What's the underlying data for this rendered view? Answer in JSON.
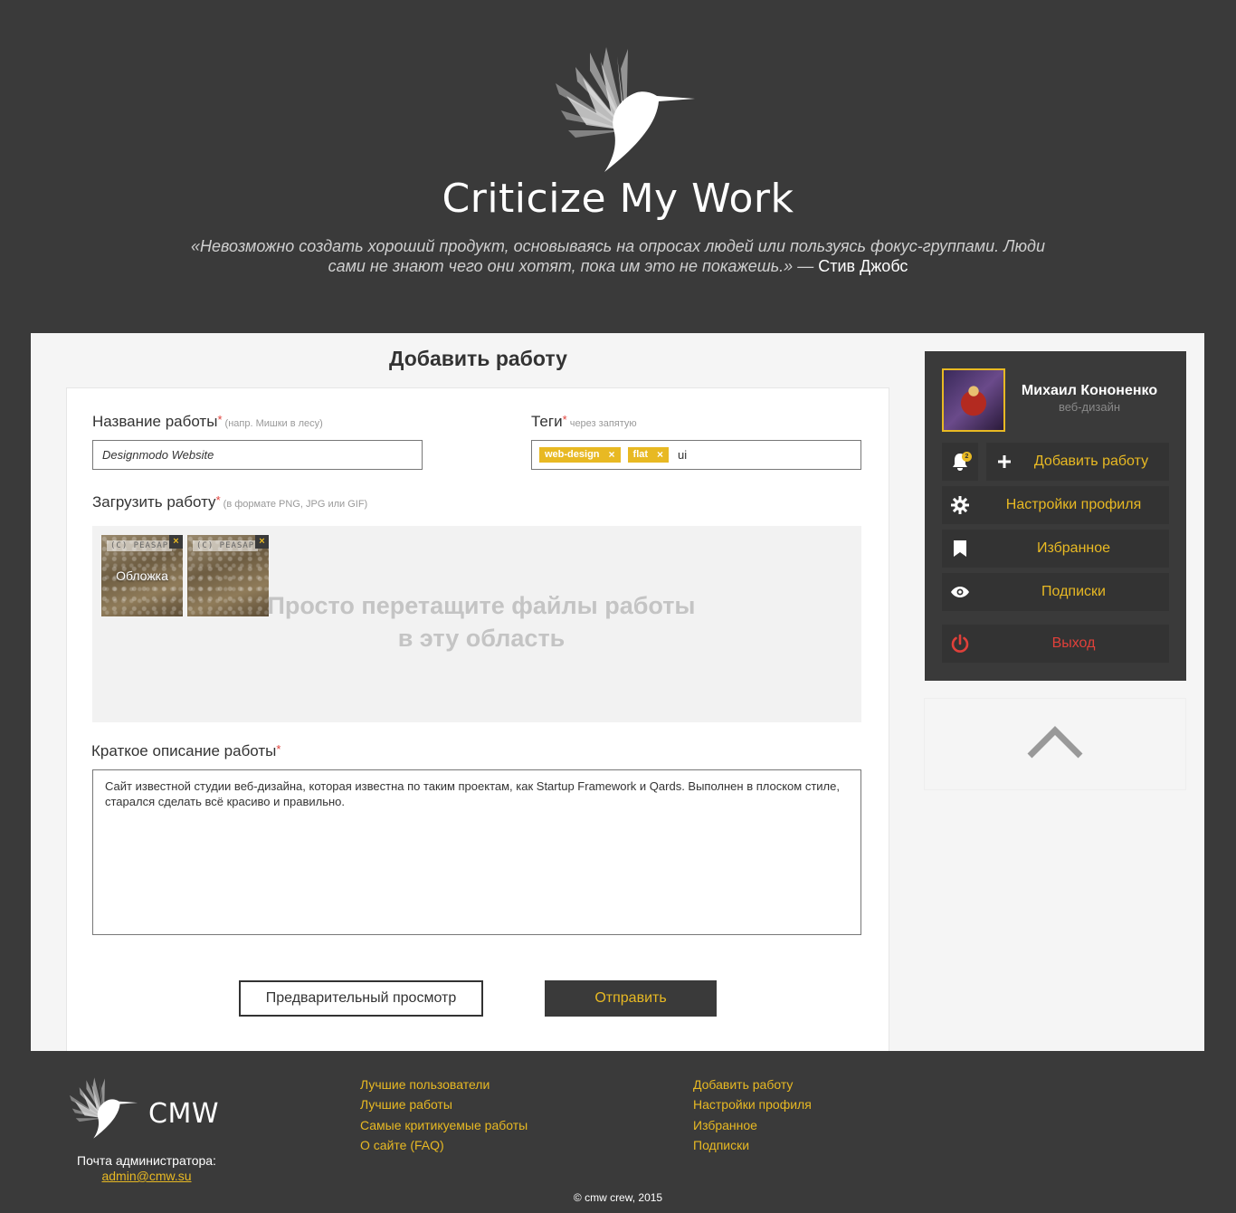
{
  "header": {
    "site_title": "Criticize My Work",
    "quote_text": "«Невозможно создать хороший продукт, основываясь на опросах людей или пользуясь фокус-группами. Люди сами не знают чего они хотят, пока им это не покажешь.»",
    "quote_dash": " — ",
    "quote_author": "Стив Джобс"
  },
  "form": {
    "heading": "Добавить работу",
    "title_label": "Название работы",
    "title_required": "*",
    "title_hint": " (напр. Мишки в лесу)",
    "title_value": "Designmodo Website",
    "tags_label": "Теги",
    "tags_required": "*",
    "tags_hint": " через запятую",
    "tags": [
      {
        "label": "web-design",
        "remove": "×"
      },
      {
        "label": "flat",
        "remove": "×"
      }
    ],
    "tags_typing": "ui",
    "upload_label": "Загрузить работу",
    "upload_required": "*",
    "upload_hint": " (в формате PNG, JPG или GIF)",
    "dropzone_line1": "Просто перетащите файлы работы",
    "dropzone_line2": "в эту область",
    "thumbnails": [
      {
        "watermark": "(C) PEASAP",
        "remove": "×",
        "caption": "Обложка"
      },
      {
        "watermark": "(C) PEASAP",
        "remove": "×",
        "caption": ""
      }
    ],
    "desc_label": "Краткое описание работы",
    "desc_required": "*",
    "desc_value": "Сайт известной студии веб-дизайна, которая известна по таким проектам, как Startup Framework и Qards. Выполнен в плоском стиле, старался сделать всё красиво и правильно.",
    "preview_button": "Предварительный просмотр",
    "submit_button": "Отправить"
  },
  "sidebar": {
    "user_name": "Михаил Кононенко",
    "user_role": "веб-дизайн",
    "notifications_count": "2",
    "add_work": "Добавить работу",
    "settings": "Настройки профиля",
    "favorites": "Избранное",
    "subscriptions": "Подписки",
    "logout": "Выход"
  },
  "footer": {
    "brand": "CMW",
    "admin_label": "Почта администратора:",
    "admin_email": "admin@cmw.su",
    "col1": [
      "Лучшие пользователи",
      "Лучшие работы",
      "Самые критикуемые работы",
      "О сайте (FAQ)"
    ],
    "col2": [
      "Добавить работу",
      "Настройки профиля",
      "Избранное",
      "Подписки"
    ],
    "copyright": "© cmw crew, 2015"
  },
  "colors": {
    "background": "#3a3a3a",
    "accent": "#e8b923",
    "danger": "#e0403a"
  }
}
